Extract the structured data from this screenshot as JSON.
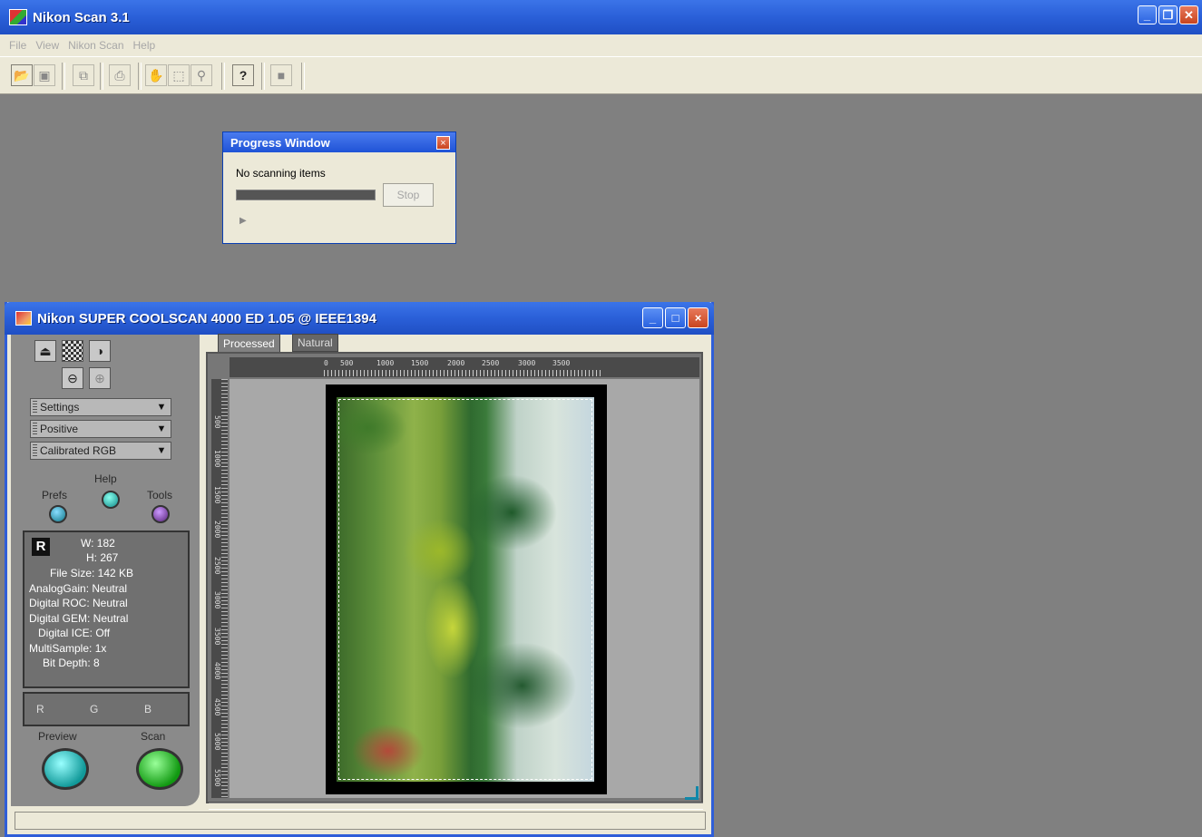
{
  "app": {
    "title": "Nikon Scan 3.1",
    "menu": [
      "File",
      "View",
      "Nikon Scan",
      "Help"
    ]
  },
  "toolbar": {
    "buttons": [
      {
        "name": "open-icon",
        "glyph": "📂"
      },
      {
        "name": "save-icon",
        "glyph": "▣"
      },
      {
        "name": "copy-icon",
        "glyph": "⧉"
      },
      {
        "name": "print-icon",
        "glyph": "⎙"
      },
      {
        "name": "hand-icon",
        "glyph": "✋"
      },
      {
        "name": "marquee-icon",
        "glyph": "⬚"
      },
      {
        "name": "zoom-icon",
        "glyph": "⚲"
      },
      {
        "name": "help-icon",
        "glyph": "?"
      },
      {
        "name": "stop-icon",
        "glyph": "■"
      }
    ]
  },
  "progress_window": {
    "title": "Progress Window",
    "close": "×",
    "message": "No scanning items",
    "stop_label": "Stop",
    "progress": 1.0,
    "expand": "▶"
  },
  "scanner_window": {
    "title": "Nikon SUPER COOLSCAN 4000 ED 1.05 @ IEEE1394",
    "minimize": "_",
    "maximize": "□",
    "close": "×",
    "dropdowns": [
      "Settings",
      "Positive",
      "Calibrated RGB"
    ],
    "labels": {
      "help": "Help",
      "prefs": "Prefs",
      "tools": "Tools",
      "preview": "Preview",
      "scan": "Scan"
    },
    "info": {
      "badge": "R",
      "w": "W: 182",
      "h": "H: 267",
      "file_size": "File Size: 142 KB",
      "analog_gain": "AnalogGain: Neutral",
      "digital_roc": "Digital ROC: Neutral",
      "digital_gem": "Digital GEM: Neutral",
      "digital_ice": "Digital ICE: Off",
      "multisample": "MultiSample: 1x",
      "bit_depth": "Bit Depth: 8"
    },
    "rgb": [
      "R",
      "G",
      "B"
    ],
    "tabs": [
      "Processed",
      "Natural"
    ],
    "ruler_top": [
      "0",
      "500",
      "1000",
      "1500",
      "2000",
      "2500",
      "3000",
      "3500"
    ],
    "ruler_left": [
      "500",
      "1000",
      "1500",
      "2000",
      "2500",
      "3000",
      "3500",
      "4000",
      "4500",
      "5000",
      "5500"
    ]
  }
}
